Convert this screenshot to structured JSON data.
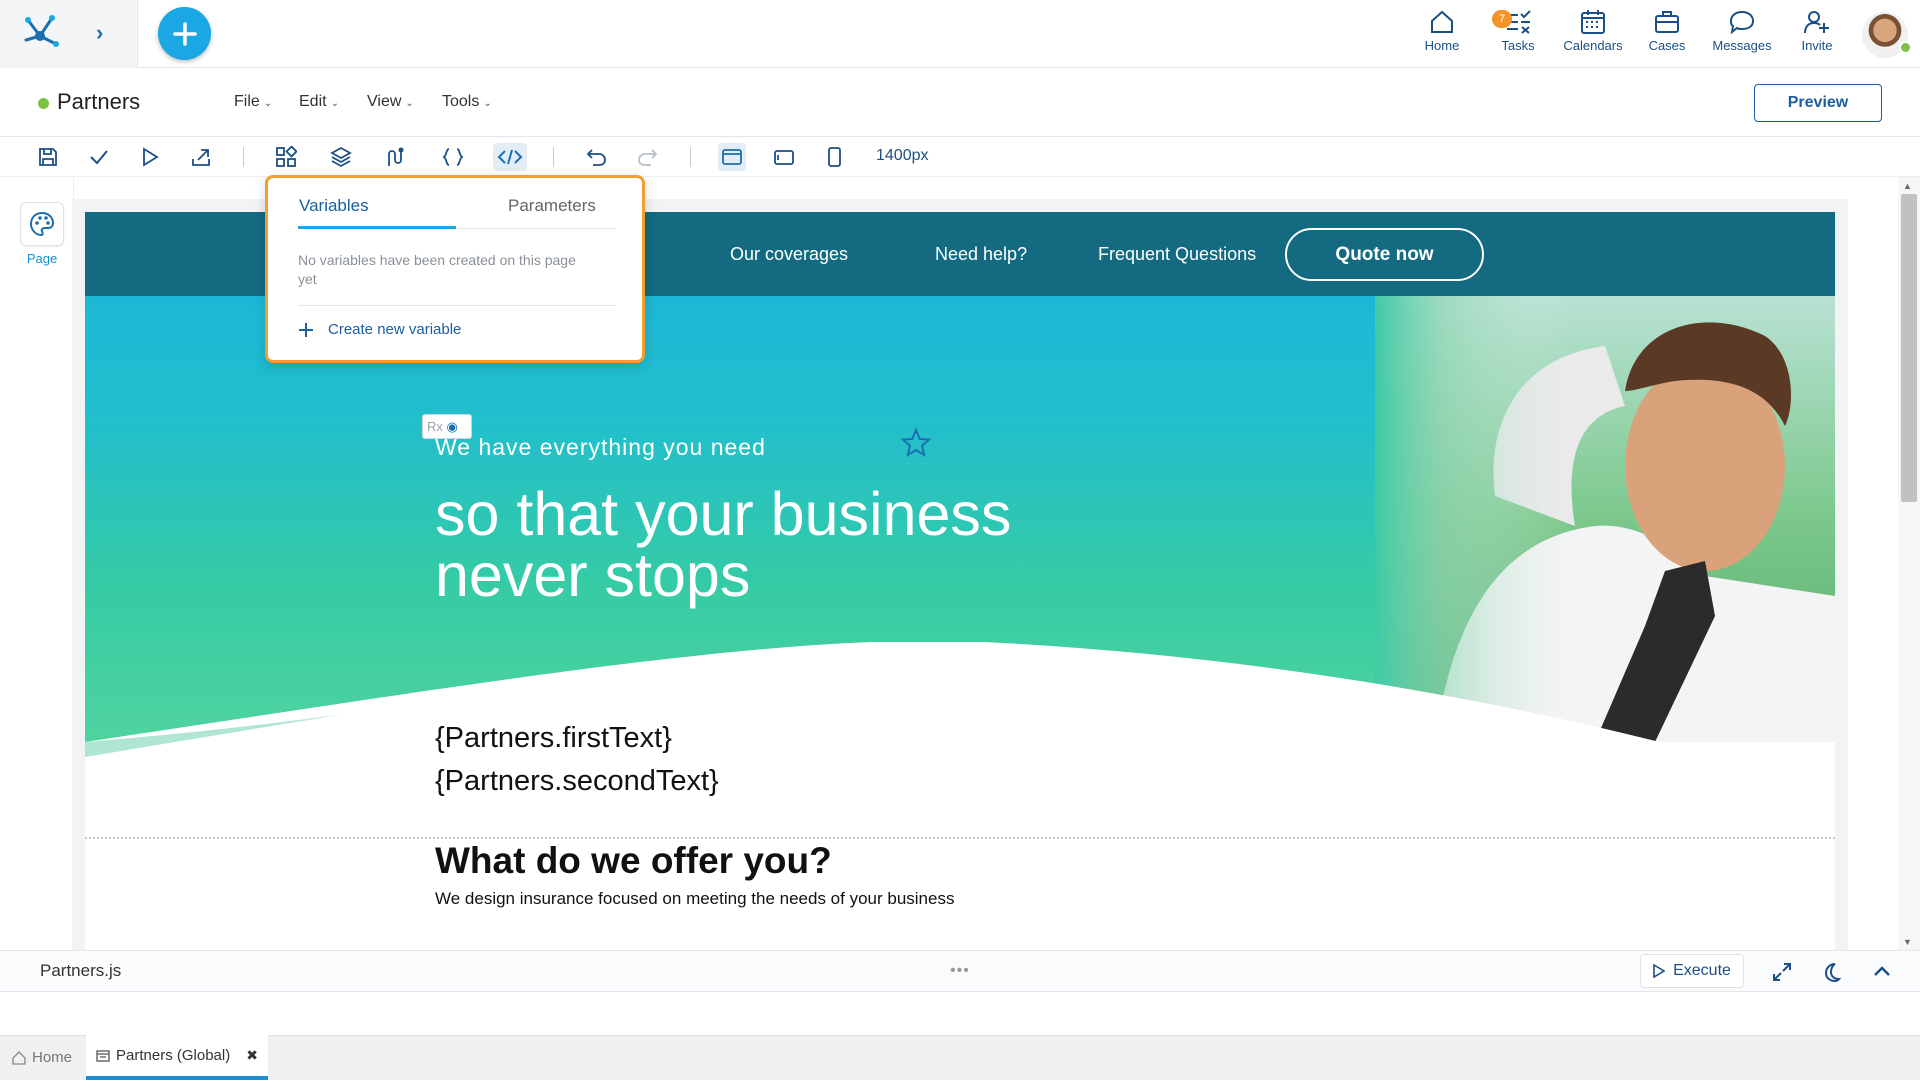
{
  "topnav": {
    "items": [
      {
        "label": "Home",
        "icon": "home-icon"
      },
      {
        "label": "Tasks",
        "icon": "tasks-icon",
        "badge": "7"
      },
      {
        "label": "Calendars",
        "icon": "calendar-icon"
      },
      {
        "label": "Cases",
        "icon": "briefcase-icon"
      },
      {
        "label": "Messages",
        "icon": "chat-icon"
      },
      {
        "label": "Invite",
        "icon": "invite-user-icon"
      }
    ]
  },
  "header": {
    "title": "Partners",
    "status_color": "#7cc142",
    "menu": [
      "File",
      "Edit",
      "View",
      "Tools"
    ],
    "preview_label": "Preview"
  },
  "toolbar": {
    "icons": [
      "save-icon",
      "check-icon",
      "run-icon",
      "publish-icon",
      "widgets-icon",
      "layers-icon",
      "flow-icon",
      "braces-icon",
      "code-icon",
      "undo-icon",
      "redo-icon",
      "desktop-view-icon",
      "tablet-view-icon",
      "mobile-view-icon"
    ],
    "width_label": "1400px"
  },
  "leftpanel": {
    "page_label": "Page"
  },
  "design": {
    "nav_links": [
      "Our coverages",
      "Need help?",
      "Frequent Questions"
    ],
    "quote_button": "Quote now",
    "rx_tag": "Rx",
    "hero_small": "We have everything you need",
    "hero_big": "so that your business never stops",
    "var_line_1": "{Partners.firstText}",
    "var_line_2": "{Partners.secondText}",
    "offer_title": "What do we offer you?",
    "offer_subtitle": "We design insurance focused on meeting the needs of your business"
  },
  "popover": {
    "tab_variables": "Variables",
    "tab_parameters": "Parameters",
    "empty_message": "No variables have been created on this page yet",
    "create_label": "Create new variable",
    "border_color": "#f0a030"
  },
  "code_panel": {
    "file_name": "Partners.js",
    "dots": "•••",
    "execute_label": "Execute"
  },
  "bottom_tabs": [
    {
      "label": "Home",
      "icon": "home-icon"
    },
    {
      "label": "Partners (Global)",
      "icon": "page-icon",
      "active": true
    }
  ]
}
